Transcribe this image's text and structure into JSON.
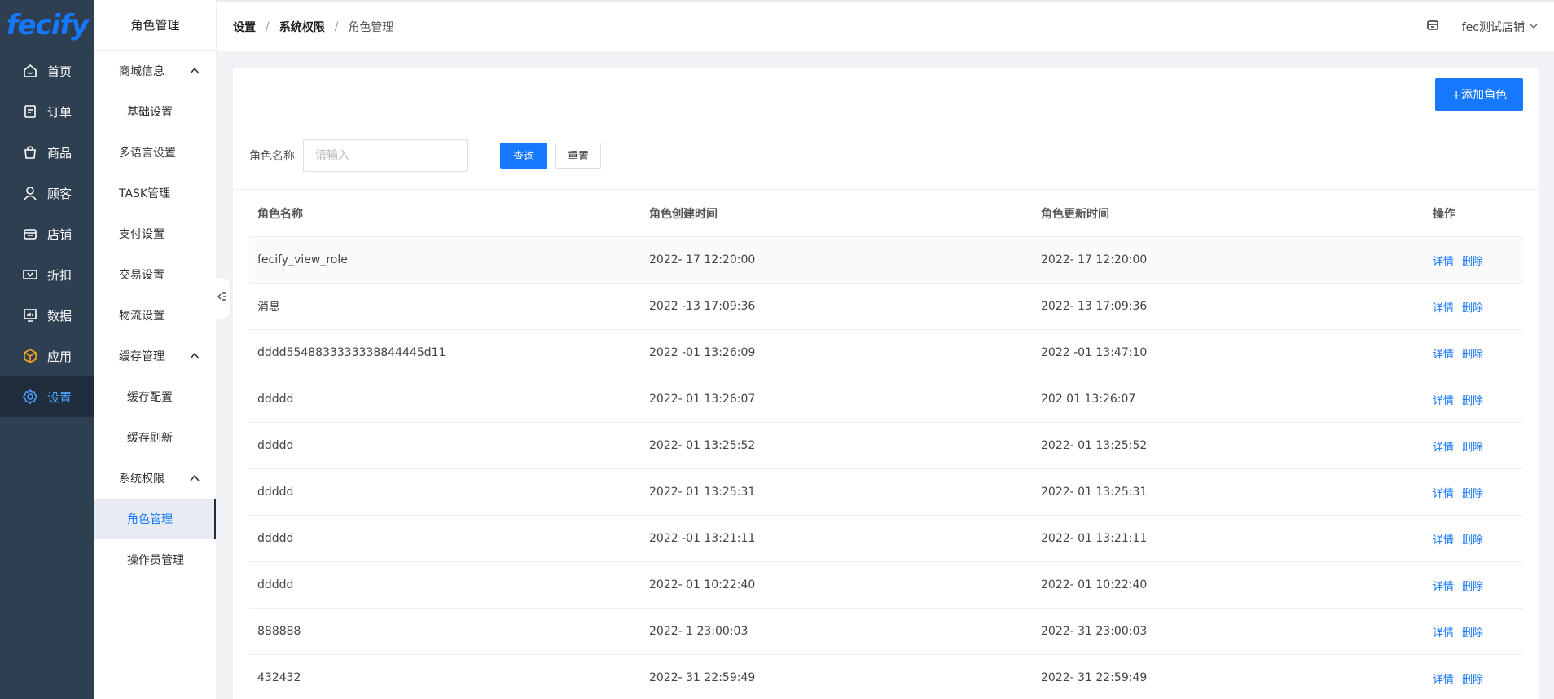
{
  "brand": {
    "logo": "fecify"
  },
  "nav": [
    {
      "label": "首页",
      "icon": "home-icon"
    },
    {
      "label": "订单",
      "icon": "order-icon"
    },
    {
      "label": "商品",
      "icon": "bag-icon"
    },
    {
      "label": "顾客",
      "icon": "user-icon"
    },
    {
      "label": "店铺",
      "icon": "store-icon"
    },
    {
      "label": "折扣",
      "icon": "ticket-icon"
    },
    {
      "label": "数据",
      "icon": "chart-icon"
    },
    {
      "label": "应用",
      "icon": "cube-icon"
    },
    {
      "label": "设置",
      "icon": "gear-icon"
    }
  ],
  "submenu": {
    "title": "角色管理",
    "groups": {
      "mall": "商城信息",
      "basic": "基础设置",
      "lang": "多语言设置",
      "task": "TASK管理",
      "pay": "支付设置",
      "trade": "交易设置",
      "logistics": "物流设置",
      "cache": "缓存管理",
      "cache_config": "缓存配置",
      "cache_refresh": "缓存刷新",
      "perm": "系统权限",
      "role": "角色管理",
      "operator": "操作员管理"
    }
  },
  "breadcrumb": {
    "level1": "设置",
    "level2": "系统权限",
    "level3": "角色管理",
    "sep": "/"
  },
  "header": {
    "shop": "fec测试店铺"
  },
  "toolbar": {
    "add_role": "+添加角色"
  },
  "filter": {
    "label": "角色名称",
    "placeholder": "请输入",
    "query": "查询",
    "reset": "重置"
  },
  "table": {
    "columns": [
      "角色名称",
      "角色创建时间",
      "角色更新时间",
      "操作"
    ],
    "actions": {
      "detail": "详情",
      "delete": "删除"
    },
    "rows": [
      {
        "name": "fecify_view_role",
        "created": "2022-  17 12:20:00",
        "updated": "2022-  17 12:20:00"
      },
      {
        "name": "消息",
        "created": "2022  -13 17:09:36",
        "updated": "2022-  13 17:09:36"
      },
      {
        "name": "dddd5548833333338844445d11",
        "created": "2022  -01 13:26:09",
        "updated": "2022  -01 13:47:10"
      },
      {
        "name": "ddddd",
        "created": "2022-  01 13:26:07",
        "updated": "202   01 13:26:07"
      },
      {
        "name": "ddddd",
        "created": "2022-  01 13:25:52",
        "updated": "2022-  01 13:25:52"
      },
      {
        "name": "ddddd",
        "created": "2022-  01 13:25:31",
        "updated": "2022-  01 13:25:31"
      },
      {
        "name": "ddddd",
        "created": "2022  -01 13:21:11",
        "updated": "2022-  01 13:21:11"
      },
      {
        "name": "ddddd",
        "created": "2022-  01 10:22:40",
        "updated": "2022-  01 10:22:40"
      },
      {
        "name": "888888",
        "created": "2022-  1 23:00:03",
        "updated": "2022-  31 23:00:03"
      },
      {
        "name": "432432",
        "created": "2022-  31 22:59:49",
        "updated": "2022-  31 22:59:49"
      }
    ]
  }
}
